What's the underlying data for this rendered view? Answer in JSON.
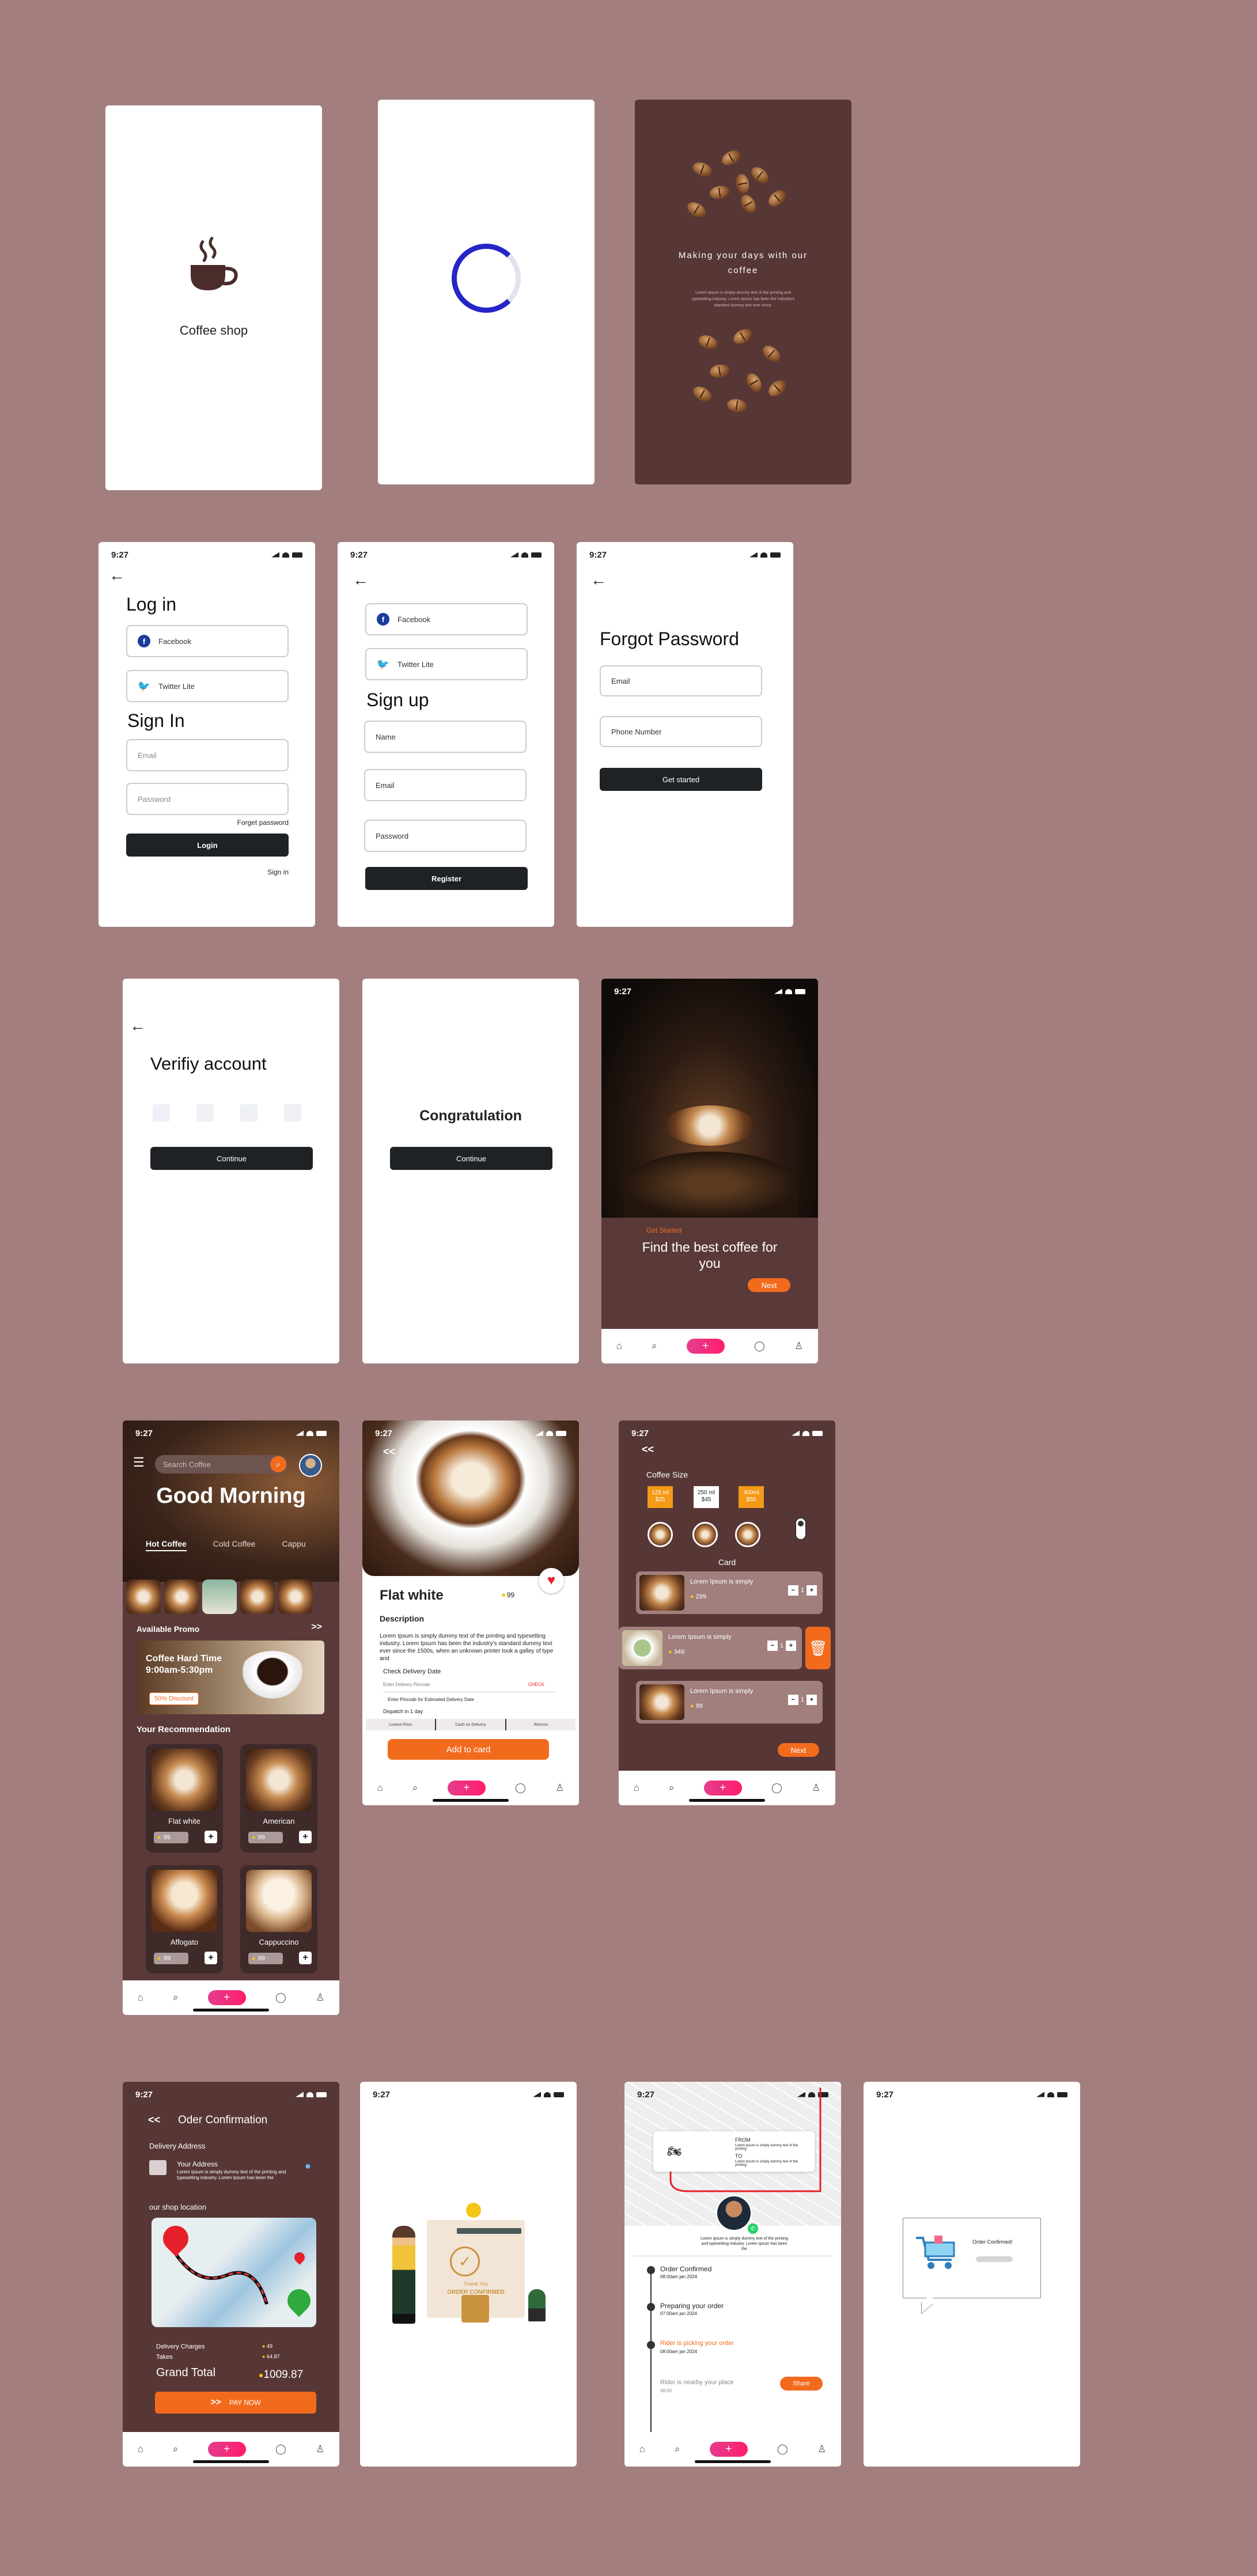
{
  "status_time": "9:27",
  "splash": {
    "app_name": "Coffee shop"
  },
  "onboard": {
    "heading": "Making your days with our coffee",
    "body": "Lorem Ipsum is simply dummy text of the printing and typesetting industry. Lorem Ipsum has been the industry's standard dummy text ever since."
  },
  "login": {
    "title": "Log in",
    "facebook": "Facebook",
    "twitter": "Twitter Lite",
    "signin_title": "Sign In",
    "email_placeholder": "Email",
    "password_placeholder": "Password",
    "forgot": "Forget password",
    "login_btn": "Login",
    "signin_link": "Sign in"
  },
  "signup": {
    "facebook": "Facebook",
    "twitter": "Twitter Lite",
    "title": "Sign up",
    "name": "Name",
    "email": "Email",
    "password": "Password",
    "register_btn": "Register"
  },
  "forgot": {
    "title": "Forgot Password",
    "email": "Email",
    "phone": "Phone Number",
    "btn": "Get  started"
  },
  "verify": {
    "title": "Verifiy account",
    "btn": "Continue"
  },
  "congrats": {
    "title": "Congratulation",
    "btn": "Continue"
  },
  "getstarted": {
    "tag": "Get Started",
    "heading": "Find the best coffee for you",
    "next": "Next"
  },
  "home": {
    "search_placeholder": "Search Coffee",
    "greeting": "Good Morning",
    "tabs": [
      "Hot Coffee",
      "Cold Coffee",
      "Cappu"
    ],
    "promo_title": "Available Promo",
    "promo_more": ">>",
    "promo_text": "Coffee Hard Time 9:00am-5:30pm",
    "promo_badge": "50% Discount",
    "rec_title": "Your Recommendation",
    "items": [
      {
        "name": "Flat white",
        "price": "99"
      },
      {
        "name": "American",
        "price": "99"
      },
      {
        "name": "Affogato",
        "price": "99"
      },
      {
        "name": "Cappuccino",
        "price": "99"
      }
    ]
  },
  "detail": {
    "back": "<<",
    "name": "Flat white",
    "rating": "99",
    "desc_title": "Description",
    "desc": "Lorem Ipsum is simply dummy text of the printing and typesetting industry. Lorem Ipsum has been the industry's standard dummy text ever since the 1500s, when an unknown printer took a galley of type and",
    "delivery_title": "Check Delivery Date",
    "pincode": "Enter Delivery Pincode",
    "check": "CHECK",
    "opt1": "Enter Pincode for Estimated Delivery Date",
    "dispatch": "Dispatch in 1 day",
    "tabs": [
      "Lowest Price",
      "Cash on Delivery",
      "Returns"
    ],
    "add_btn": "Add to card"
  },
  "cart": {
    "back": "<<",
    "size_title": "Coffee Size",
    "sizes": [
      {
        "label": "125 ml",
        "price": "$25"
      },
      {
        "label": "250 ml",
        "price": "$45"
      },
      {
        "label": "400ml",
        "price": "$55"
      }
    ],
    "card_title": "Card",
    "items": [
      {
        "text": "Lorem Ipsum is simply",
        "price": "299",
        "qty": "1"
      },
      {
        "text": "Lorem Ipsum is simply",
        "price": "349",
        "qty": "1"
      },
      {
        "text": "Lorem Ipsum is simply",
        "price": "99",
        "qty": "1"
      }
    ],
    "next": "Next"
  },
  "order": {
    "back": "<<",
    "title": "Oder Confirmation",
    "addr_title": "Delivery Address",
    "addr_label": "Your Address",
    "addr_text": "Lorem Ipsum is simply dummy text of the printing and typesetting industry. Lorem Ipsum has been the",
    "shop_title": "our shop location",
    "charges_label": "Delivery  Charges",
    "charges": "49",
    "takes_label": "Takes",
    "takes": "64.87",
    "total_label": "Grand Total",
    "total": "1009.87",
    "pay": "PAY NOW"
  },
  "thanks": {
    "line1": "Thank You",
    "line2": "ORDER CONFIRMED"
  },
  "track": {
    "from": "FROM",
    "from_text": "Lorem Ipsum is simply dummy text of the printing",
    "to": "TO",
    "to_text": "Lorem Ipsum is simply dummy text of the printing",
    "driver_text": "Lorem Ipsum is simply dummy text of the printing and typesetting industry. Lorem Ipsum has been the",
    "steps": [
      {
        "title": "Order Confirmed",
        "time": "08:00am jan 2024"
      },
      {
        "title": "Preparing your order",
        "time": "07:00am jan 2024"
      },
      {
        "title": "Rider is picking your order",
        "time": "08:00am jan 2024"
      },
      {
        "title": "Rider is nearby your place",
        "time": "08:00"
      }
    ],
    "share": "Share"
  },
  "cart_confirm": {
    "title": "Order Confirmed!"
  },
  "colors": {
    "bg": "#a27f7e",
    "brown": "#5a3a39",
    "orange": "#f26b1d",
    "pink": "#ff1d6c",
    "dark_btn": "#1f2224"
  }
}
